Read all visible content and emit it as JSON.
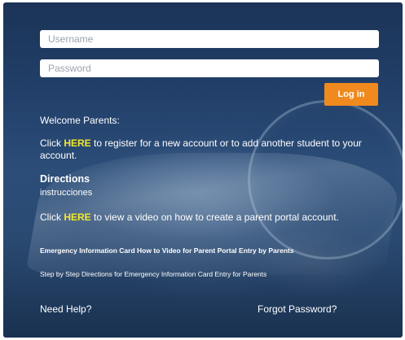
{
  "login": {
    "username_placeholder": "Username",
    "password_placeholder": "Password",
    "login_label": "Log in"
  },
  "welcome": {
    "heading": "Welcome Parents:",
    "register_prefix": "Click ",
    "register_link": "HERE",
    "register_suffix": " to register for a new account or to add another student to your account."
  },
  "directions": {
    "title": "Directions",
    "subtitle": "instrucciones",
    "video_prefix": "Click ",
    "video_link": "HERE",
    "video_suffix": " to view a video on how to create a parent portal account."
  },
  "links": {
    "emergency_video": "Emergency Information Card How to Video for Parent Portal Entry by Parents",
    "step_by_step": "Step by Step Directions for Emergency Information Card Entry for Parents",
    "need_help": "Need Help?",
    "forgot_password": "Forgot Password?"
  },
  "colors": {
    "accent_button": "#f08a1e",
    "link_highlight": "#f5e82a",
    "background": "#22406a"
  }
}
